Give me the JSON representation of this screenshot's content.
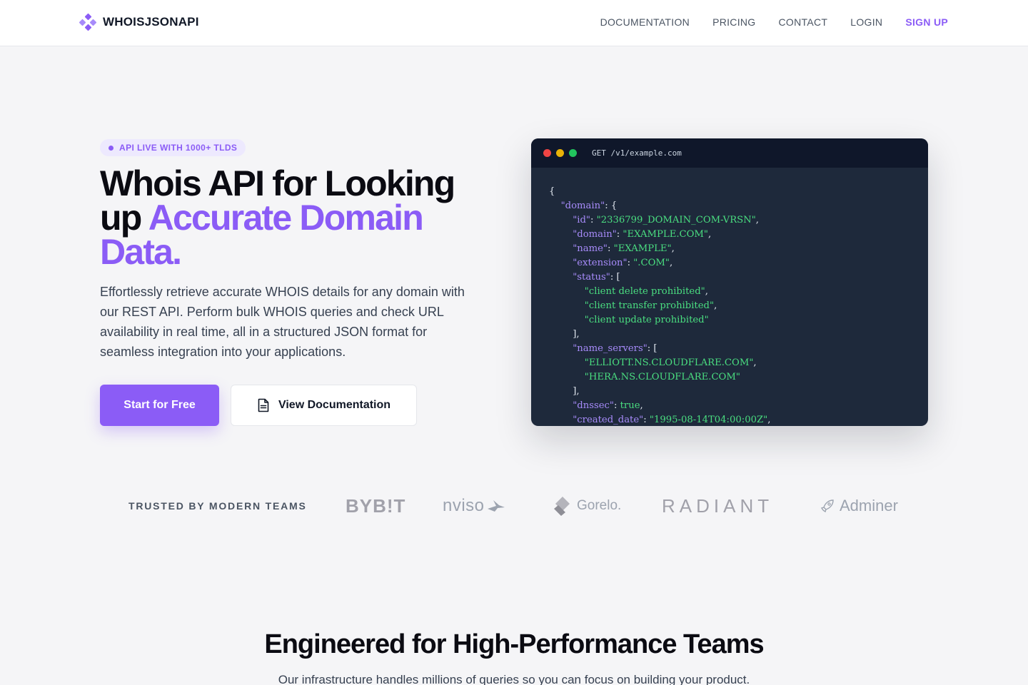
{
  "nav": {
    "logo_text": "WHOISJSONAPI",
    "links": [
      "DOCUMENTATION",
      "PRICING",
      "CONTACT",
      "LOGIN"
    ],
    "signup": "SIGN UP",
    "accent_color": "#8b5cf6"
  },
  "hero": {
    "badge": "API LIVE WITH 1000+ TLDS",
    "title_part1": "Whois API for Looking up ",
    "title_accent": "Accurate Domain Data.",
    "description": "Effortlessly retrieve accurate WHOIS details for any domain with our REST API. Perform bulk WHOIS queries and check URL availability in real time, all in a structured JSON format for seamless integration into your applications.",
    "primary_button": "Start for Free",
    "secondary_button": "View Documentation",
    "secondary_icon": "document-icon"
  },
  "code": {
    "request": "GET /v1/example.com",
    "lines": [
      {
        "indent": 0,
        "parts": [
          [
            "p",
            "{"
          ]
        ]
      },
      {
        "indent": 1,
        "parts": [
          [
            "k",
            "\"domain\""
          ],
          [
            "p",
            ": {"
          ]
        ]
      },
      {
        "indent": 2,
        "parts": [
          [
            "k",
            "\"id\""
          ],
          [
            "p",
            ": "
          ],
          [
            "s",
            "\"2336799_DOMAIN_COM-VRSN\""
          ],
          [
            "p",
            ","
          ]
        ]
      },
      {
        "indent": 2,
        "parts": [
          [
            "k",
            "\"domain\""
          ],
          [
            "p",
            ": "
          ],
          [
            "s",
            "\"EXAMPLE.COM\""
          ],
          [
            "p",
            ","
          ]
        ]
      },
      {
        "indent": 2,
        "parts": [
          [
            "k",
            "\"name\""
          ],
          [
            "p",
            ": "
          ],
          [
            "s",
            "\"EXAMPLE\""
          ],
          [
            "p",
            ","
          ]
        ]
      },
      {
        "indent": 2,
        "parts": [
          [
            "k",
            "\"extension\""
          ],
          [
            "p",
            ": "
          ],
          [
            "s",
            "\".COM\""
          ],
          [
            "p",
            ","
          ]
        ]
      },
      {
        "indent": 2,
        "parts": [
          [
            "k",
            "\"status\""
          ],
          [
            "p",
            ": ["
          ]
        ]
      },
      {
        "indent": 3,
        "parts": [
          [
            "s",
            "\"client delete prohibited\""
          ],
          [
            "p",
            ","
          ]
        ]
      },
      {
        "indent": 3,
        "parts": [
          [
            "s",
            "\"client transfer prohibited\""
          ],
          [
            "p",
            ","
          ]
        ]
      },
      {
        "indent": 3,
        "parts": [
          [
            "s",
            "\"client update prohibited\""
          ]
        ]
      },
      {
        "indent": 2,
        "parts": [
          [
            "p",
            "],"
          ]
        ]
      },
      {
        "indent": 2,
        "parts": [
          [
            "k",
            "\"name_servers\""
          ],
          [
            "p",
            ": ["
          ]
        ]
      },
      {
        "indent": 3,
        "parts": [
          [
            "s",
            "\"ELLIOTT.NS.CLOUDFLARE.COM\""
          ],
          [
            "p",
            ","
          ]
        ]
      },
      {
        "indent": 3,
        "parts": [
          [
            "s",
            "\"HERA.NS.CLOUDFLARE.COM\""
          ]
        ]
      },
      {
        "indent": 2,
        "parts": [
          [
            "p",
            "],"
          ]
        ]
      },
      {
        "indent": 2,
        "parts": [
          [
            "k",
            "\"dnssec\""
          ],
          [
            "p",
            ": "
          ],
          [
            "s",
            "true"
          ],
          [
            "p",
            ","
          ]
        ]
      },
      {
        "indent": 2,
        "parts": [
          [
            "k",
            "\"created_date\""
          ],
          [
            "p",
            ": "
          ],
          [
            "s",
            "\"1995-08-14T04:00:00Z\""
          ],
          [
            "p",
            ","
          ]
        ]
      }
    ]
  },
  "trusted": {
    "label": "TRUSTED BY MODERN TEAMS",
    "brands": [
      "BYB!T",
      "nviso",
      "Gorelo.",
      "RADIANT",
      "Adminer"
    ]
  },
  "section": {
    "title": "Engineered for High-Performance Teams",
    "subtitle": "Our infrastructure handles millions of queries so you can focus on building your product."
  }
}
